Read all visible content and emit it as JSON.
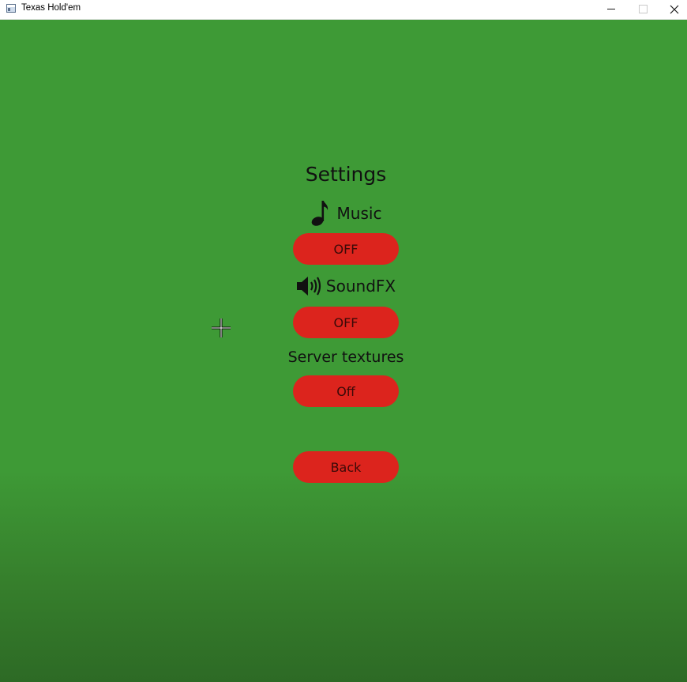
{
  "window": {
    "title": "Texas Hold'em",
    "app_icon": "window-app-icon",
    "controls": {
      "minimize_icon": "minimize-icon",
      "maximize_icon": "maximize-icon",
      "close_icon": "close-icon"
    }
  },
  "settings": {
    "title": "Settings",
    "music": {
      "icon": "music-note-icon",
      "label": "Music",
      "button_label": "OFF"
    },
    "soundfx": {
      "icon": "speaker-icon",
      "label": "SoundFX",
      "button_label": "OFF"
    },
    "server_textures": {
      "label": "Server textures",
      "button_label": "Off"
    },
    "back_label": "Back"
  },
  "colors": {
    "background_green": "#3e9a36",
    "background_green_dark": "#2d6a25",
    "button_red": "#dc241d",
    "button_text": "#3b0a08"
  },
  "cursor": "crosshair-cursor"
}
